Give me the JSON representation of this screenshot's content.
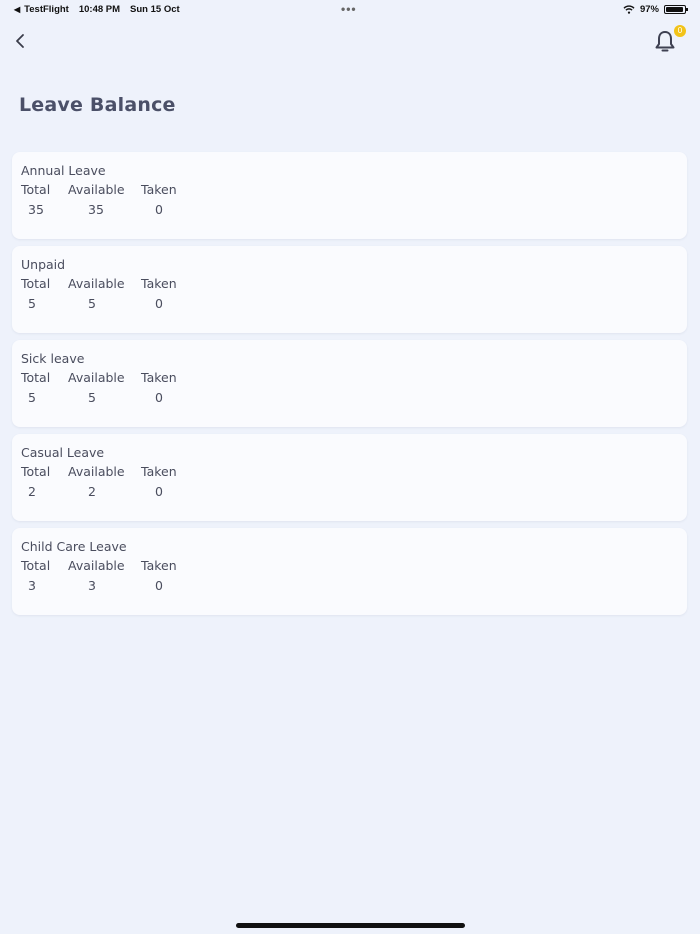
{
  "status_bar": {
    "back_app": "TestFlight",
    "time": "10:48 PM",
    "date": "Sun 15 Oct",
    "dots": "•••",
    "battery": "97%"
  },
  "notifications": {
    "badge_count": "0"
  },
  "page": {
    "title": "Leave Balance"
  },
  "column_labels": {
    "total": "Total",
    "available": "Available",
    "taken": "Taken"
  },
  "leaves": [
    {
      "name": "Annual Leave",
      "total": "35",
      "available": "35",
      "taken": "0"
    },
    {
      "name": "Unpaid",
      "total": "5",
      "available": "5",
      "taken": "0"
    },
    {
      "name": "Sick leave",
      "total": "5",
      "available": "5",
      "taken": "0"
    },
    {
      "name": "Casual Leave",
      "total": "2",
      "available": "2",
      "taken": "0"
    },
    {
      "name": "Child Care Leave",
      "total": "3",
      "available": "3",
      "taken": "0"
    }
  ],
  "colors": {
    "background": "#eef2fb",
    "card": "#fafbfe",
    "badge": "#f2c318",
    "title": "#4b5068"
  },
  "icons": {
    "back": "chevron-left-icon",
    "notifications": "bell-icon",
    "wifi": "wifi-icon",
    "battery": "battery-icon"
  }
}
